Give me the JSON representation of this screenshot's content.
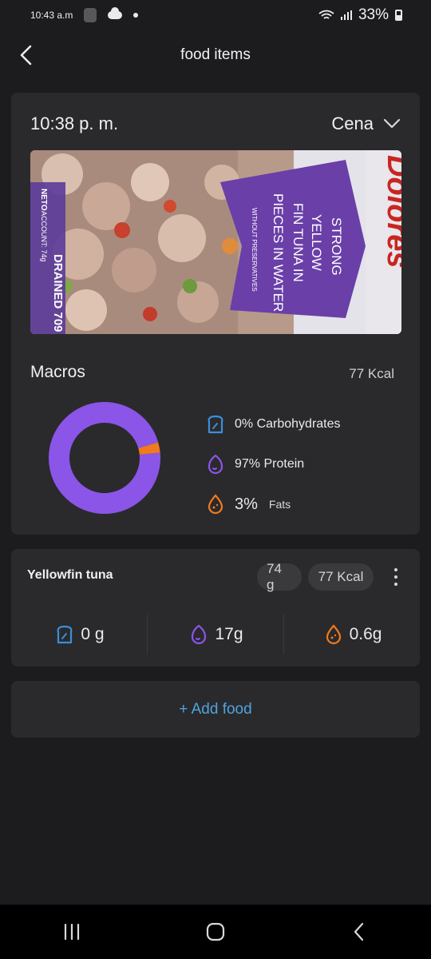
{
  "status": {
    "time": "10:43 a.m",
    "battery": "33%"
  },
  "header": {
    "title": "food items"
  },
  "meal": {
    "time": "10:38 p. m.",
    "type": "Cena"
  },
  "photo": {
    "brand": "Dolores",
    "line1": "STRONG",
    "line2": "YELLOW",
    "line3": "FIN TUNA IN",
    "line4": "PIECES IN WATER",
    "line5": "WITHOUT PRESERVATIVES",
    "side1": "DRAINED 709",
    "side2": "ACCOUNT: 74g",
    "side3": "NETO"
  },
  "macros": {
    "title": "Macros",
    "kcal_value": "77",
    "kcal_unit": "Kcal",
    "carbs_label": "0% Carbohydrates",
    "protein_label": "97% Protein",
    "fats_pct": "3%",
    "fats_label": "Fats",
    "chart_data": {
      "type": "pie",
      "categories": [
        "Carbohydrates",
        "Protein",
        "Fats"
      ],
      "values": [
        0,
        97,
        3
      ],
      "colors": [
        "#3b8fd9",
        "#8b55e8",
        "#f07a1e"
      ]
    }
  },
  "food": {
    "name": "Yellowfin tuna",
    "weight": "74 g",
    "kcal": "77 Kcal",
    "carbs": "0 g",
    "protein": "17g",
    "fats": "0.6g"
  },
  "add": {
    "label": "+ Add food"
  },
  "colors": {
    "carbs": "#3b8fd9",
    "protein": "#8b55e8",
    "fats": "#f07a1e",
    "accent": "#4fa3e0"
  }
}
